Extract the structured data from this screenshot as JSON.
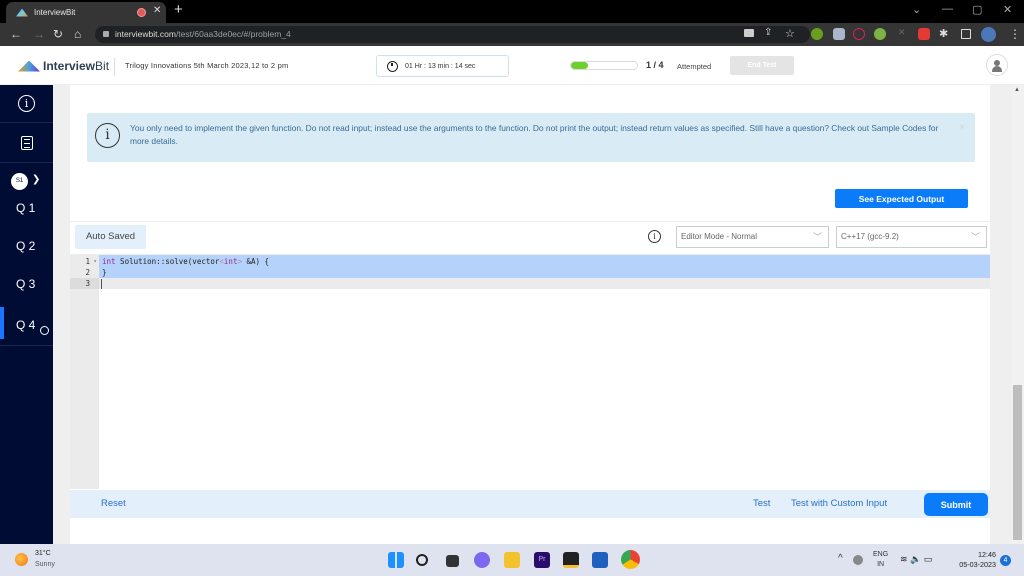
{
  "browser": {
    "tab_title": "InterviewBit",
    "new_tab": "+",
    "url_domain": "interviewbit.com",
    "url_path": "/test/60aa3de0ec/#/problem_4",
    "window_controls": [
      "⌄",
      "—",
      "▢",
      "✕"
    ],
    "extensions": [
      "camera-icon",
      "share-icon",
      "star-icon",
      "green-plus-ext",
      "shield-ext",
      "record-ext",
      "frog-ext",
      "x-ext",
      "lock-ext",
      "puzzle-icon",
      "sidebar-icon",
      "profile-avatar",
      "menu-icon"
    ]
  },
  "header": {
    "brand_bold": "Interview",
    "brand_light": "Bit",
    "test_name": "Trilogy Innovations 5th March 2023,12 to 2 pm",
    "timer": "01 Hr : 13 min : 14 sec",
    "progress_fraction": 0.25,
    "attempt_count": "1 / 4",
    "attempt_label": "Attempted",
    "end_test_label": "End Test"
  },
  "sidebar": {
    "section_badge": "S1",
    "questions": [
      {
        "label": "Q 1",
        "active": false
      },
      {
        "label": "Q 2",
        "active": false
      },
      {
        "label": "Q 3",
        "active": false
      },
      {
        "label": "Q 4",
        "active": true
      }
    ]
  },
  "notice": {
    "text": "You only need to implement the given function. Do not read input; instead use the arguments to the function. Do not print the output; instead return values as specified. Still have a question? Check out Sample Codes for more details.",
    "close": "×"
  },
  "toolbar": {
    "expected_output_label": "See Expected Output",
    "auto_saved": "Auto Saved",
    "editor_mode": "Editor Mode - Normal",
    "language": "C++17 (gcc-9.2)"
  },
  "editor": {
    "lines": [
      {
        "num": "1",
        "fold": "▾"
      },
      {
        "num": "2"
      },
      {
        "num": "3"
      }
    ],
    "code_line1_kw": "int",
    "code_line1_a": " Solution::solve(vector",
    "code_line1_lt": "<",
    "code_line1_kw2": "int",
    "code_line1_gt": ">",
    "code_line1_b": " &A) {",
    "code_line2": "}"
  },
  "footer": {
    "reset": "Reset",
    "test": "Test",
    "custom_test": "Test with Custom Input",
    "submit": "Submit"
  },
  "taskbar": {
    "temperature": "31°C",
    "condition": "Sunny",
    "lang_1": "ENG",
    "lang_2": "IN",
    "time": "12:46",
    "date": "05-03-2023",
    "notifications": "4"
  }
}
